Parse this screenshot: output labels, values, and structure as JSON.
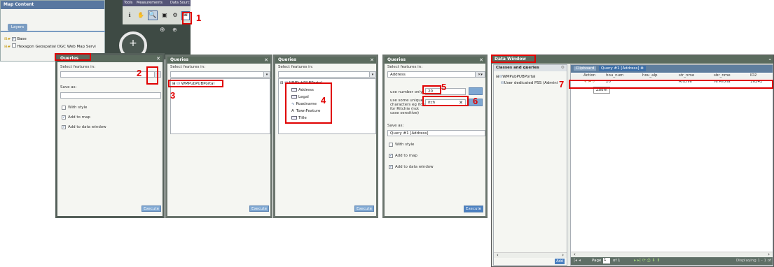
{
  "map_panel": {
    "title": "Map Content",
    "layers_tab": "Layers",
    "layers": [
      "Base",
      "Hexagon Geospatial OGC Web Map Servi"
    ]
  },
  "toolbar_tabs": [
    "Tools",
    "Measurements",
    "Data Sourc"
  ],
  "callouts": [
    "1",
    "2",
    "3",
    "4",
    "5",
    "6",
    "7"
  ],
  "queries1": {
    "title": "Queries",
    "select_label": "Select features in:",
    "save_label": "Save as:",
    "with_style": "With style",
    "add_to_map": "Add to map",
    "add_to_data": "Add to data window",
    "execute": "Execute"
  },
  "queries2": {
    "title": "Queries",
    "select_label": "Select features in:",
    "tree_item": "WMPubPUBPortal",
    "execute": "Execute"
  },
  "queries3": {
    "title": "Queries",
    "select_label": "Select features in:",
    "tree_root": "WMPubPUBPortal",
    "items": [
      "Address",
      "Legal",
      "Roadname",
      "TownFeature",
      "Title"
    ],
    "execute": "Execute"
  },
  "queries4": {
    "title": "Queries",
    "select_label": "Select features in:",
    "selected": "Address",
    "field1_label": "use number only",
    "field1_value": "20",
    "field2_label": "use some unique characters eg itch for Ritchie (not case sensitive)",
    "field2_value": "itch",
    "clear_symbol": "✕",
    "save_label": "Save as:",
    "save_value": "Query #1 [Address]",
    "with_style": "With style",
    "add_to_map": "Add to map",
    "add_to_data": "Add to data window",
    "execute": "Execute"
  },
  "data_window": {
    "title": "Data Window",
    "left_header": "Classes and queries",
    "tree": [
      "WMPubPUBPortal",
      "User dedicated PSS (Admini"
    ],
    "tabs": [
      "Clipboard",
      "Query #1 [Address]"
    ],
    "columns": [
      "Action",
      "hou_num",
      "hou_alp",
      "str_nme",
      "sbr_nme",
      "ID2"
    ],
    "row": {
      "hou_num": "20",
      "hou_alp": "",
      "str_nme": "Ritchie",
      "sbr_nme": "Te Aroha",
      "ID2": "16242"
    },
    "tooltip": "Zoom",
    "add_button": "Add",
    "page_label": "Page",
    "page_value": "1",
    "page_of": "of 1",
    "displaying": "Displaying 1 - 1 of"
  },
  "colors": {
    "callout": "#e00000",
    "titlebar": "#4f7fae",
    "dark_titlebar": "#5b6b5e",
    "execute": "#7ea7d2"
  }
}
